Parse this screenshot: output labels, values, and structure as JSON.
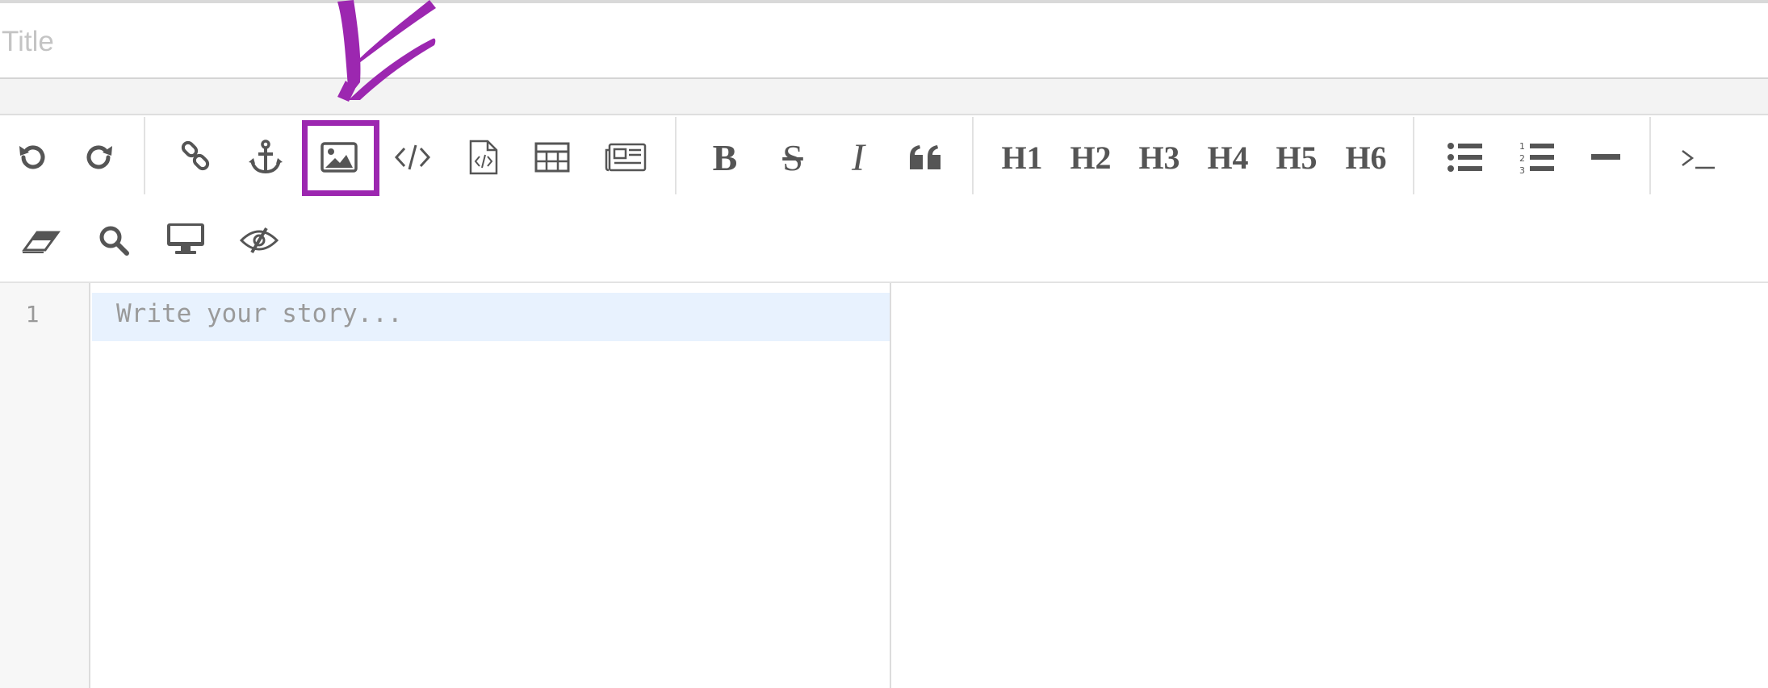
{
  "title": {
    "placeholder": "Title"
  },
  "toolbar": {
    "row1": [
      {
        "name": "undo-icon",
        "label": "Undo"
      },
      {
        "name": "redo-icon",
        "label": "Redo"
      },
      {
        "name": "link-icon",
        "label": "Link"
      },
      {
        "name": "anchor-icon",
        "label": "Anchor"
      },
      {
        "name": "image-icon",
        "label": "Image",
        "highlighted": true
      },
      {
        "name": "code-icon",
        "label": "Code"
      },
      {
        "name": "code-file-icon",
        "label": "Code Block"
      },
      {
        "name": "table-icon",
        "label": "Table"
      },
      {
        "name": "newspaper-icon",
        "label": "Page Break"
      },
      {
        "name": "bold-icon",
        "text": "B"
      },
      {
        "name": "strikethrough-icon",
        "text": "S"
      },
      {
        "name": "italic-icon",
        "text": "I"
      },
      {
        "name": "quote-icon",
        "text": "“"
      },
      {
        "name": "h1-button",
        "text": "H1"
      },
      {
        "name": "h2-button",
        "text": "H2"
      },
      {
        "name": "h3-button",
        "text": "H3"
      },
      {
        "name": "h4-button",
        "text": "H4"
      },
      {
        "name": "h5-button",
        "text": "H5"
      },
      {
        "name": "h6-button",
        "text": "H6"
      },
      {
        "name": "bullet-list-icon",
        "label": "Unordered List"
      },
      {
        "name": "numbered-list-icon",
        "label": "Ordered List"
      },
      {
        "name": "horizontal-rule-icon",
        "label": "Horizontal Rule"
      },
      {
        "name": "terminal-icon",
        "label": "Terminal"
      }
    ],
    "row2": [
      {
        "name": "eraser-icon",
        "label": "Clear"
      },
      {
        "name": "search-icon",
        "label": "Search"
      },
      {
        "name": "desktop-icon",
        "label": "Preview"
      },
      {
        "name": "eye-slash-icon",
        "label": "Hide Preview"
      }
    ],
    "h_labels": [
      "H1",
      "H2",
      "H3",
      "H4",
      "H5",
      "H6"
    ],
    "bold_label": "B",
    "strike_label": "S",
    "italic_label": "I"
  },
  "editor": {
    "line_number": "1",
    "placeholder": "Write your story..."
  },
  "colors": {
    "highlight": "#9c27b0",
    "icon": "#555555",
    "active_line": "#e8f2fe"
  }
}
